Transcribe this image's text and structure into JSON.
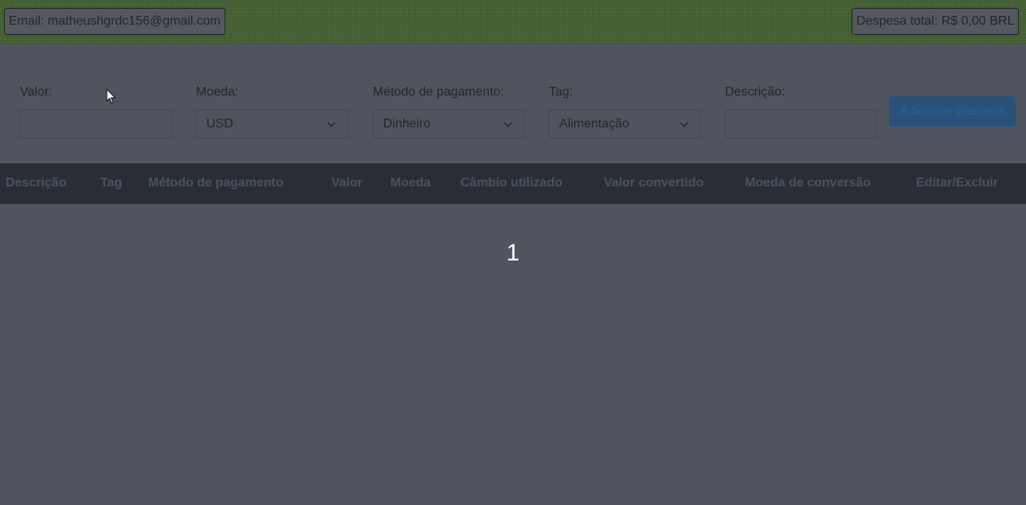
{
  "header": {
    "email": "Email: matheushgrdc156@gmail.com",
    "total": "Despesa total: R$ 0,00 BRL"
  },
  "form": {
    "valor_label": "Valor:",
    "valor_value": "",
    "moeda_label": "Moeda:",
    "moeda_value": "USD",
    "metodo_label": "Método de pagamento:",
    "metodo_value": "Dinheiro",
    "tag_label": "Tag:",
    "tag_value": "Alimentação",
    "descricao_label": "Descrição:",
    "descricao_value": "",
    "add_button": "Adicionar despesa"
  },
  "table": {
    "headers": [
      "Descrição",
      "Tag",
      "Método de pagamento",
      "Valor",
      "Moeda",
      "Câmbio utilizado",
      "Valor convertido",
      "Moeda de conversão",
      "Editar/Excluir"
    ]
  },
  "pagination": {
    "current_page": "1"
  },
  "colors": {
    "background": "#50545e",
    "header": "#3f5a30",
    "table_header": "#292e36",
    "button": "#28507a"
  },
  "icons": {
    "select_arrow": "chevron-down-icon",
    "pointer": "mouse-cursor-icon"
  }
}
